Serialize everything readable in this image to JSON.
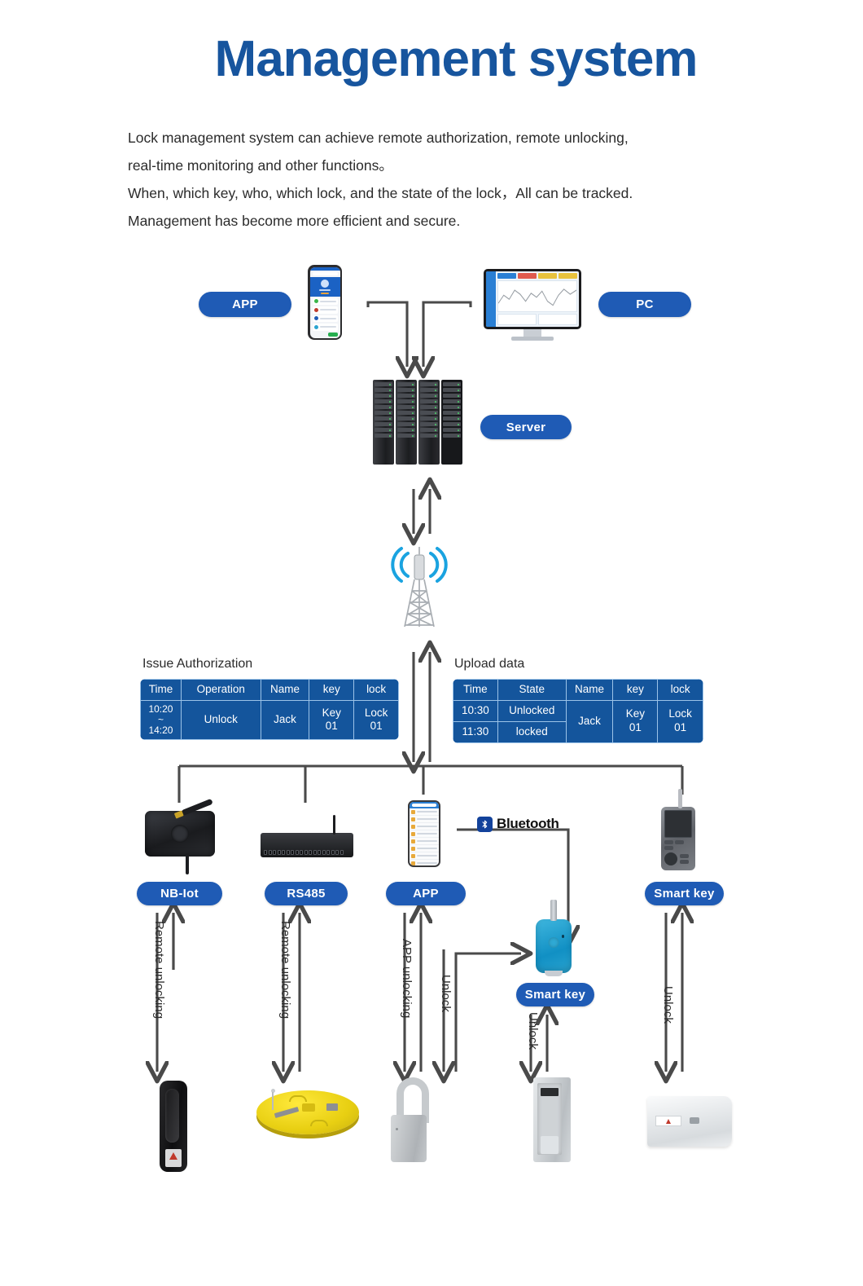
{
  "header": {
    "title": "Management system",
    "paragraphs": [
      "Lock management system can achieve remote authorization, remote unlocking,",
      "real-time monitoring and other functions。",
      "When, which key, who, which lock, and the state of the lock，All can be tracked.",
      "Management has become more efficient and secure."
    ]
  },
  "colors": {
    "title_blue": "#17559E",
    "badge_blue": "#1F5BB5",
    "table_blue": "#14559C",
    "table_border": "#9cc3e8",
    "bluetooth_blue": "#13429B",
    "wire_gray": "#4a4a4a",
    "fob_blue": "#1190C4"
  },
  "top_tier": {
    "app_label": "APP",
    "pc_label": "PC",
    "server_label": "Server"
  },
  "tables": {
    "issue": {
      "caption": "Issue Authorization",
      "headers": [
        "Time",
        "Operation",
        "Name",
        "key",
        "lock"
      ],
      "rows": [
        [
          "10:20\n~\n14:20",
          "Unlock",
          "Jack",
          "Key 01",
          "Lock 01"
        ]
      ]
    },
    "upload": {
      "caption": "Upload data",
      "headers": [
        "Time",
        "State",
        "Name",
        "key",
        "lock"
      ],
      "rows": [
        [
          "10:30",
          "Unlocked",
          "Jack",
          "Key 01",
          "Lock 01"
        ],
        [
          "11:30",
          "locked",
          "",
          "",
          ""
        ]
      ]
    }
  },
  "channels": [
    {
      "label": "NB-Iot",
      "icon": "nb-iot-gateway-icon"
    },
    {
      "label": "RS485",
      "icon": "rs485-router-icon"
    },
    {
      "label": "APP",
      "icon": "mobile-app-icon"
    },
    {
      "label": "Smart key",
      "icon": "handheld-reader-icon"
    }
  ],
  "bluetooth": {
    "label": "Bluetooth",
    "icon": "bluetooth-icon"
  },
  "smart_key_fob": {
    "label": "Smart key",
    "icon": "key-fob-icon"
  },
  "flow_labels": {
    "remote_unlocking_1": "Remote unlocking",
    "remote_unlocking_2": "Remote unlocking",
    "app_unlocking": "APP unlocking",
    "unlock_app_to_fob": "Unlock",
    "unlock_fob_to_lock": "Unlock",
    "unlock_handheld": "Unlock"
  },
  "locks": [
    {
      "icon": "swing-handle-lock-icon"
    },
    {
      "icon": "manhole-cover-lock-icon"
    },
    {
      "icon": "padlock-icon"
    },
    {
      "icon": "cabinet-lock-icon"
    },
    {
      "icon": "box-lock-icon"
    }
  ]
}
